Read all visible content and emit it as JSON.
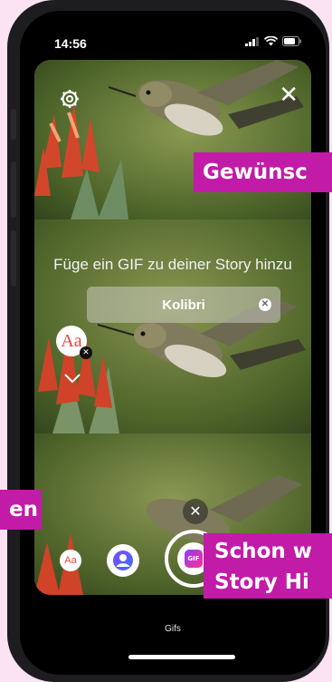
{
  "status_bar": {
    "time": "14:56"
  },
  "gif_picker": {
    "title": "Füge ein GIF zu deiner Story hinzu",
    "search_value": "Kolibri"
  },
  "text_style": {
    "label": "Aa"
  },
  "toolbar": {
    "text_label": "Aa",
    "gif_label": "GIF"
  },
  "bottom": {
    "mode_label": "Gifs"
  },
  "overlays": {
    "top_caption": "Gewünsc",
    "left_caption": "en",
    "bottom_caption_line1": "Schon w",
    "bottom_caption_line2": "Story Hi"
  },
  "colors": {
    "page_bg": "#fbe3f3",
    "caption_bg": "#c21ba8",
    "gif_gradient_start": "#8b3dff",
    "gif_gradient_end": "#ff2e8a"
  }
}
